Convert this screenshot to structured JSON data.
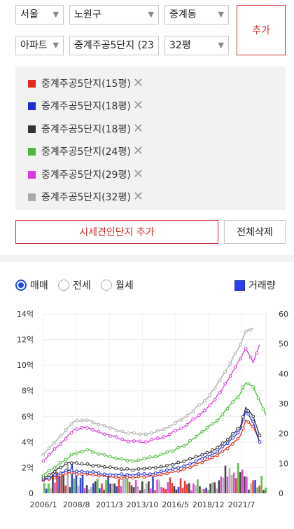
{
  "selectors": {
    "city": "서울",
    "district": "노원구",
    "dong": "중계동",
    "type": "아파트",
    "complex": "중계주공5단지 (23",
    "size": "32평"
  },
  "add_label": "추가",
  "list_items": [
    {
      "label": "중계주공5단지(15평)",
      "color": "#e02b20"
    },
    {
      "label": "중계주공5단지(18평)",
      "color": "#1e2fd8"
    },
    {
      "label": "중계주공5단지(18평)",
      "color": "#333333"
    },
    {
      "label": "중계주공5단지(24평)",
      "color": "#4cb83a"
    },
    {
      "label": "중계주공5단지(29평)",
      "color": "#d93ad9"
    },
    {
      "label": "중계주공5단지(32평)",
      "color": "#aaaaaa"
    }
  ],
  "remove_icon": "close-icon",
  "add_reference_label": "시세견인단지 추가",
  "clear_all_label": "전체삭제",
  "radios": [
    "매매",
    "전세",
    "월세"
  ],
  "radio_selected": 0,
  "volume_label": "거래량",
  "colors": {
    "accent": "#d32f2f",
    "radio": "#1e4fd8",
    "volume": "#2b3ff0"
  },
  "chart_data": {
    "type": "line",
    "x_start": "2006-01",
    "x_end": "2023-06",
    "x_ticks": [
      "2006/1",
      "2008/8",
      "2011/3",
      "2013/10",
      "2016/5",
      "2018/12",
      "2021/7"
    ],
    "y_left_ticks": [
      "0",
      "2억",
      "4억",
      "6억",
      "8억",
      "10억",
      "12억",
      "14억"
    ],
    "y_left_range": [
      0,
      14
    ],
    "y_left_unit": "억",
    "y_right_ticks": [
      "0",
      "10",
      "20",
      "30",
      "40",
      "50",
      "60"
    ],
    "y_right_range": [
      0,
      60
    ],
    "grid": true,
    "series": [
      {
        "color": "#e02b20",
        "points": [
          [
            "2006-01",
            1.0
          ],
          [
            "2008-01",
            1.6
          ],
          [
            "2009-01",
            1.5
          ],
          [
            "2011-01",
            1.3
          ],
          [
            "2013-01",
            1.2
          ],
          [
            "2015-01",
            1.4
          ],
          [
            "2017-01",
            1.9
          ],
          [
            "2018-06",
            2.4
          ],
          [
            "2019-06",
            2.9
          ],
          [
            "2020-06",
            3.5
          ],
          [
            "2021-06",
            4.5
          ],
          [
            "2021-11",
            5.7
          ],
          [
            "2022-06",
            5.2
          ],
          [
            "2022-12",
            4.0
          ]
        ]
      },
      {
        "color": "#1e2fd8",
        "points": [
          [
            "2006-01",
            1.1
          ],
          [
            "2008-01",
            1.8
          ],
          [
            "2009-01",
            1.7
          ],
          [
            "2011-01",
            1.5
          ],
          [
            "2013-01",
            1.4
          ],
          [
            "2015-01",
            1.6
          ],
          [
            "2017-01",
            2.1
          ],
          [
            "2018-06",
            2.7
          ],
          [
            "2019-06",
            3.1
          ],
          [
            "2020-06",
            3.9
          ],
          [
            "2021-06",
            5.0
          ],
          [
            "2021-11",
            6.4
          ],
          [
            "2022-06",
            5.6
          ],
          [
            "2022-12",
            4.0
          ]
        ]
      },
      {
        "color": "#333333",
        "points": [
          [
            "2006-01",
            1.2
          ],
          [
            "2008-01",
            2.4
          ],
          [
            "2009-01",
            2.3
          ],
          [
            "2011-01",
            2.0
          ],
          [
            "2013-01",
            1.8
          ],
          [
            "2015-01",
            2.0
          ],
          [
            "2017-01",
            2.5
          ],
          [
            "2018-06",
            3.0
          ],
          [
            "2019-06",
            3.4
          ],
          [
            "2020-06",
            4.2
          ],
          [
            "2021-06",
            5.2
          ],
          [
            "2021-11",
            6.7
          ],
          [
            "2022-06",
            6.0
          ],
          [
            "2022-12",
            4.5
          ]
        ]
      },
      {
        "color": "#4cb83a",
        "points": [
          [
            "2006-01",
            1.4
          ],
          [
            "2008-06",
            3.1
          ],
          [
            "2009-06",
            3.4
          ],
          [
            "2011-01",
            2.9
          ],
          [
            "2013-01",
            2.5
          ],
          [
            "2015-01",
            2.9
          ],
          [
            "2017-01",
            3.7
          ],
          [
            "2018-06",
            4.8
          ],
          [
            "2019-06",
            5.5
          ],
          [
            "2020-06",
            6.6
          ],
          [
            "2021-06",
            7.8
          ],
          [
            "2021-11",
            8.6
          ],
          [
            "2022-06",
            8.3
          ],
          [
            "2023-06",
            6.1
          ]
        ]
      },
      {
        "color": "#d93ad9",
        "points": [
          [
            "2006-01",
            2.5
          ],
          [
            "2008-06",
            5.0
          ],
          [
            "2009-06",
            5.1
          ],
          [
            "2011-01",
            4.6
          ],
          [
            "2012-06",
            4.1
          ],
          [
            "2014-01",
            4.0
          ],
          [
            "2015-06",
            4.4
          ],
          [
            "2017-01",
            5.2
          ],
          [
            "2018-06",
            6.3
          ],
          [
            "2019-06",
            7.3
          ],
          [
            "2020-06",
            8.8
          ],
          [
            "2021-06",
            10.5
          ],
          [
            "2021-11",
            11.3
          ],
          [
            "2022-06",
            10.2
          ],
          [
            "2022-12",
            11.6
          ]
        ]
      },
      {
        "color": "#aaaaaa",
        "points": [
          [
            "2006-01",
            3.0
          ],
          [
            "2008-06",
            5.6
          ],
          [
            "2009-06",
            5.7
          ],
          [
            "2011-01",
            5.2
          ],
          [
            "2012-06",
            4.7
          ],
          [
            "2014-01",
            4.6
          ],
          [
            "2015-06",
            5.0
          ],
          [
            "2017-01",
            5.9
          ],
          [
            "2018-06",
            7.0
          ],
          [
            "2019-06",
            8.2
          ],
          [
            "2020-06",
            9.8
          ],
          [
            "2021-06",
            11.6
          ],
          [
            "2021-11",
            12.6
          ],
          [
            "2022-06",
            12.9
          ]
        ]
      }
    ]
  }
}
